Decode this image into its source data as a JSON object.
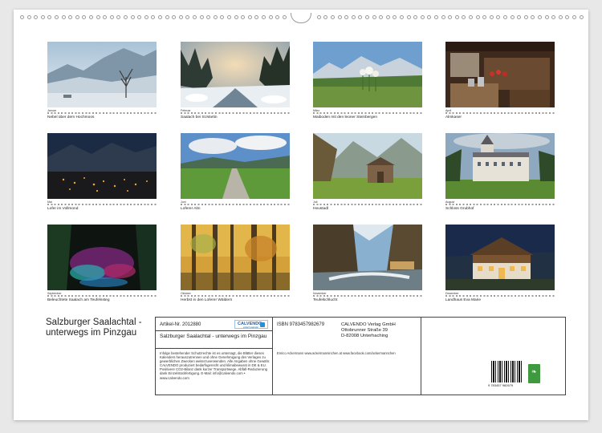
{
  "calendar": {
    "title": "Salzburger Saalachtal - unterwegs im Pinzgau",
    "months": [
      {
        "month": "Januar",
        "caption": "Nebel über dem Hochmoos"
      },
      {
        "month": "Februar",
        "caption": "Saalach bei St.Martin"
      },
      {
        "month": "März",
        "caption": "Maiboden mit den leoner Steinbergen"
      },
      {
        "month": "April",
        "caption": "Almkaser"
      },
      {
        "month": "Mai",
        "caption": "Lofer im Vollmond"
      },
      {
        "month": "Juni",
        "caption": "Loferer Alm"
      },
      {
        "month": "Juli",
        "caption": "Heustadl"
      },
      {
        "month": "August",
        "caption": "Schloss Grubhof"
      },
      {
        "month": "September",
        "caption": "Beleuchtete Saalach am Teufelssteg"
      },
      {
        "month": "Oktober",
        "caption": "Herbst in den Loferer Wäldern"
      },
      {
        "month": "November",
        "caption": "Teufelschlucht"
      },
      {
        "month": "Dezember",
        "caption": "Landhaus Eva Marie"
      }
    ]
  },
  "footer": {
    "big_title": "Salzburger Saalachtal - unterwegs im Pinzgau",
    "article": "Artikel-Nr. 2012880",
    "logo": "CALVENDO",
    "logo_sub": "einfach kalender",
    "book_title": "Salzburger Saalachtal - unterwegs im Pinzgau",
    "legal": "Infolge bestehender Schutzrechte ist es untersagt, die Blätter dieses Kalenders herauszutrennen und ohne Genehmigung des Verlages zu gewerblichen Zwecken weiterzuverwenden. Alle Angaben ohne Gewähr. CALVENDO produziert bedarfsgerecht und klimabewusst in DE & EU. Positivere CO2-Bilanz dank kurzer Transportwege. Abfall-Reduzierung dank Einzelstückfertigung. E-Mail: info@calvendo.com • www.calvendo.com",
    "isbn": "ISBN 9783457982679",
    "publisher": [
      "CALVENDO Verlag GmbH",
      "Ottobrunner Straße 39",
      "D-82008 Unterhaching"
    ],
    "credits": "Enrico Ackermann www.ackermanninchen.at www.facebook.com/ackermannchen",
    "barcode_number": "9 783457 982679"
  },
  "colors": {
    "sheet": "#ffffff",
    "background": "#e8e8e8",
    "fsc_green": "#3f9a3f",
    "calvendo_blue": "#1f5fa8"
  }
}
